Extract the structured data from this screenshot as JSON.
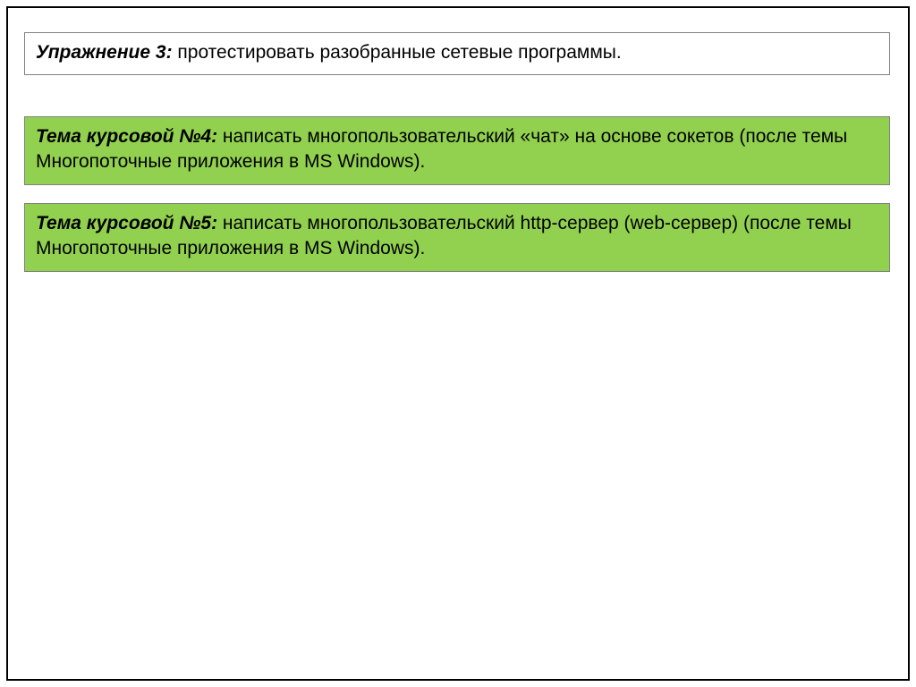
{
  "exercise3": {
    "title": "Упражнение 3:",
    "text": " протестировать разобранные сетевые программы."
  },
  "topic4": {
    "title": "Тема курсовой №4:",
    "text": " написать многопользовательский «чат» на основе сокетов (после темы Многопоточные приложения в MS Windows)."
  },
  "topic5": {
    "title": "Тема курсовой №5:",
    "text": " написать многопользовательский http-сервер (web-сервер)  (после темы Многопоточные приложения в MS Windows)."
  }
}
